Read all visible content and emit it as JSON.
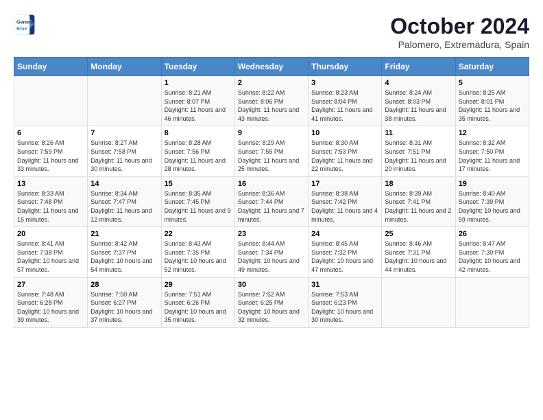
{
  "header": {
    "logo_line1": "General",
    "logo_line2": "Blue",
    "month_title": "October 2024",
    "subtitle": "Palomero, Extremadura, Spain"
  },
  "weekdays": [
    "Sunday",
    "Monday",
    "Tuesday",
    "Wednesday",
    "Thursday",
    "Friday",
    "Saturday"
  ],
  "weeks": [
    [
      {
        "day": "",
        "info": ""
      },
      {
        "day": "",
        "info": ""
      },
      {
        "day": "1",
        "info": "Sunrise: 8:21 AM\nSunset: 8:07 PM\nDaylight: 11 hours and 46 minutes."
      },
      {
        "day": "2",
        "info": "Sunrise: 8:22 AM\nSunset: 8:06 PM\nDaylight: 11 hours and 43 minutes."
      },
      {
        "day": "3",
        "info": "Sunrise: 8:23 AM\nSunset: 8:04 PM\nDaylight: 11 hours and 41 minutes."
      },
      {
        "day": "4",
        "info": "Sunrise: 8:24 AM\nSunset: 8:03 PM\nDaylight: 11 hours and 38 minutes."
      },
      {
        "day": "5",
        "info": "Sunrise: 8:25 AM\nSunset: 8:01 PM\nDaylight: 11 hours and 35 minutes."
      }
    ],
    [
      {
        "day": "6",
        "info": "Sunrise: 8:26 AM\nSunset: 7:59 PM\nDaylight: 11 hours and 33 minutes."
      },
      {
        "day": "7",
        "info": "Sunrise: 8:27 AM\nSunset: 7:58 PM\nDaylight: 11 hours and 30 minutes."
      },
      {
        "day": "8",
        "info": "Sunrise: 8:28 AM\nSunset: 7:56 PM\nDaylight: 11 hours and 28 minutes."
      },
      {
        "day": "9",
        "info": "Sunrise: 8:29 AM\nSunset: 7:55 PM\nDaylight: 11 hours and 25 minutes."
      },
      {
        "day": "10",
        "info": "Sunrise: 8:30 AM\nSunset: 7:53 PM\nDaylight: 11 hours and 22 minutes."
      },
      {
        "day": "11",
        "info": "Sunrise: 8:31 AM\nSunset: 7:51 PM\nDaylight: 11 hours and 20 minutes."
      },
      {
        "day": "12",
        "info": "Sunrise: 8:32 AM\nSunset: 7:50 PM\nDaylight: 11 hours and 17 minutes."
      }
    ],
    [
      {
        "day": "13",
        "info": "Sunrise: 8:33 AM\nSunset: 7:48 PM\nDaylight: 11 hours and 15 minutes."
      },
      {
        "day": "14",
        "info": "Sunrise: 8:34 AM\nSunset: 7:47 PM\nDaylight: 11 hours and 12 minutes."
      },
      {
        "day": "15",
        "info": "Sunrise: 8:35 AM\nSunset: 7:45 PM\nDaylight: 11 hours and 9 minutes."
      },
      {
        "day": "16",
        "info": "Sunrise: 8:36 AM\nSunset: 7:44 PM\nDaylight: 11 hours and 7 minutes."
      },
      {
        "day": "17",
        "info": "Sunrise: 8:38 AM\nSunset: 7:42 PM\nDaylight: 11 hours and 4 minutes."
      },
      {
        "day": "18",
        "info": "Sunrise: 8:39 AM\nSunset: 7:41 PM\nDaylight: 11 hours and 2 minutes."
      },
      {
        "day": "19",
        "info": "Sunrise: 8:40 AM\nSunset: 7:39 PM\nDaylight: 10 hours and 59 minutes."
      }
    ],
    [
      {
        "day": "20",
        "info": "Sunrise: 8:41 AM\nSunset: 7:38 PM\nDaylight: 10 hours and 57 minutes."
      },
      {
        "day": "21",
        "info": "Sunrise: 8:42 AM\nSunset: 7:37 PM\nDaylight: 10 hours and 54 minutes."
      },
      {
        "day": "22",
        "info": "Sunrise: 8:43 AM\nSunset: 7:35 PM\nDaylight: 10 hours and 52 minutes."
      },
      {
        "day": "23",
        "info": "Sunrise: 8:44 AM\nSunset: 7:34 PM\nDaylight: 10 hours and 49 minutes."
      },
      {
        "day": "24",
        "info": "Sunrise: 8:45 AM\nSunset: 7:32 PM\nDaylight: 10 hours and 47 minutes."
      },
      {
        "day": "25",
        "info": "Sunrise: 8:46 AM\nSunset: 7:31 PM\nDaylight: 10 hours and 44 minutes."
      },
      {
        "day": "26",
        "info": "Sunrise: 8:47 AM\nSunset: 7:30 PM\nDaylight: 10 hours and 42 minutes."
      }
    ],
    [
      {
        "day": "27",
        "info": "Sunrise: 7:48 AM\nSunset: 6:28 PM\nDaylight: 10 hours and 39 minutes."
      },
      {
        "day": "28",
        "info": "Sunrise: 7:50 AM\nSunset: 6:27 PM\nDaylight: 10 hours and 37 minutes."
      },
      {
        "day": "29",
        "info": "Sunrise: 7:51 AM\nSunset: 6:26 PM\nDaylight: 10 hours and 35 minutes."
      },
      {
        "day": "30",
        "info": "Sunrise: 7:52 AM\nSunset: 6:25 PM\nDaylight: 10 hours and 32 minutes."
      },
      {
        "day": "31",
        "info": "Sunrise: 7:53 AM\nSunset: 6:23 PM\nDaylight: 10 hours and 30 minutes."
      },
      {
        "day": "",
        "info": ""
      },
      {
        "day": "",
        "info": ""
      }
    ]
  ]
}
